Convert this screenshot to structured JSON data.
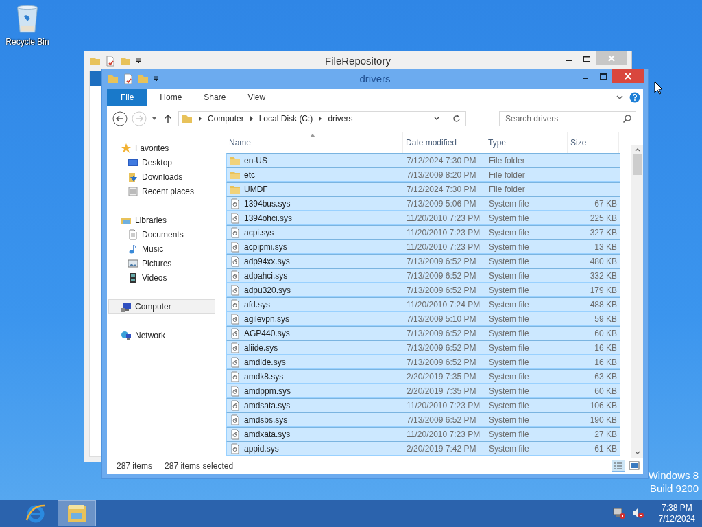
{
  "desktop": {
    "icons": [
      {
        "label": "Recycle Bin",
        "kind": "recycle"
      }
    ],
    "watermark": [
      "Windows 8",
      "Build 9200"
    ]
  },
  "back_window": {
    "title": "FileRepository"
  },
  "window": {
    "title": "drivers",
    "ribbon_tabs": [
      {
        "label": "File",
        "kind": "file"
      },
      {
        "label": "Home",
        "kind": "tab"
      },
      {
        "label": "Share",
        "kind": "tab"
      },
      {
        "label": "View",
        "kind": "tab"
      }
    ],
    "address": [
      "Computer",
      "Local Disk (C:)",
      "drivers"
    ],
    "search": {
      "placeholder": "Search drivers"
    },
    "nav": [
      {
        "label": "Favorites",
        "kind": "star",
        "selected": false,
        "children": [
          {
            "label": "Desktop",
            "kind": "desktop",
            "selected": false
          },
          {
            "label": "Downloads",
            "kind": "downloads",
            "selected": false
          },
          {
            "label": "Recent places",
            "kind": "recent",
            "selected": false
          }
        ]
      },
      {
        "label": "Libraries",
        "kind": "library",
        "selected": false,
        "children": [
          {
            "label": "Documents",
            "kind": "document",
            "selected": false
          },
          {
            "label": "Music",
            "kind": "music",
            "selected": false
          },
          {
            "label": "Pictures",
            "kind": "pictures",
            "selected": false
          },
          {
            "label": "Videos",
            "kind": "videos",
            "selected": false
          }
        ]
      },
      {
        "label": "Computer",
        "kind": "computer",
        "selected": true
      },
      {
        "label": "Network",
        "kind": "network",
        "selected": false
      }
    ],
    "columns": [
      "Name",
      "Date modified",
      "Type",
      "Size"
    ],
    "rows": [
      {
        "name": "en-US",
        "date": "7/12/2024 7:30 PM",
        "type": "File folder",
        "kind": "folder",
        "selected": true
      },
      {
        "name": "etc",
        "date": "7/13/2009 8:20 PM",
        "type": "File folder",
        "kind": "folder",
        "selected": true
      },
      {
        "name": "UMDF",
        "date": "7/12/2024 7:30 PM",
        "type": "File folder",
        "kind": "folder",
        "selected": true
      },
      {
        "name": "1394bus.sys",
        "date": "7/13/2009 5:06 PM",
        "type": "System file",
        "size": "67 KB",
        "kind": "file",
        "selected": true
      },
      {
        "name": "1394ohci.sys",
        "date": "11/20/2010 7:23 PM",
        "type": "System file",
        "size": "225 KB",
        "kind": "file",
        "selected": true
      },
      {
        "name": "acpi.sys",
        "date": "11/20/2010 7:23 PM",
        "type": "System file",
        "size": "327 KB",
        "kind": "file",
        "selected": true
      },
      {
        "name": "acpipmi.sys",
        "date": "11/20/2010 7:23 PM",
        "type": "System file",
        "size": "13 KB",
        "kind": "file",
        "selected": true
      },
      {
        "name": "adp94xx.sys",
        "date": "7/13/2009 6:52 PM",
        "type": "System file",
        "size": "480 KB",
        "kind": "file",
        "selected": true
      },
      {
        "name": "adpahci.sys",
        "date": "7/13/2009 6:52 PM",
        "type": "System file",
        "size": "332 KB",
        "kind": "file",
        "selected": true
      },
      {
        "name": "adpu320.sys",
        "date": "7/13/2009 6:52 PM",
        "type": "System file",
        "size": "179 KB",
        "kind": "file",
        "selected": true
      },
      {
        "name": "afd.sys",
        "date": "11/20/2010 7:24 PM",
        "type": "System file",
        "size": "488 KB",
        "kind": "file",
        "selected": true
      },
      {
        "name": "agilevpn.sys",
        "date": "7/13/2009 5:10 PM",
        "type": "System file",
        "size": "59 KB",
        "kind": "file",
        "selected": true
      },
      {
        "name": "AGP440.sys",
        "date": "7/13/2009 6:52 PM",
        "type": "System file",
        "size": "60 KB",
        "kind": "file",
        "selected": true
      },
      {
        "name": "aliide.sys",
        "date": "7/13/2009 6:52 PM",
        "type": "System file",
        "size": "16 KB",
        "kind": "file",
        "selected": true
      },
      {
        "name": "amdide.sys",
        "date": "7/13/2009 6:52 PM",
        "type": "System file",
        "size": "16 KB",
        "kind": "file",
        "selected": true
      },
      {
        "name": "amdk8.sys",
        "date": "2/20/2019 7:35 PM",
        "type": "System file",
        "size": "63 KB",
        "kind": "file",
        "selected": true
      },
      {
        "name": "amdppm.sys",
        "date": "2/20/2019 7:35 PM",
        "type": "System file",
        "size": "60 KB",
        "kind": "file",
        "selected": true
      },
      {
        "name": "amdsata.sys",
        "date": "11/20/2010 7:23 PM",
        "type": "System file",
        "size": "106 KB",
        "kind": "file",
        "selected": true
      },
      {
        "name": "amdsbs.sys",
        "date": "7/13/2009 6:52 PM",
        "type": "System file",
        "size": "190 KB",
        "kind": "file",
        "selected": true
      },
      {
        "name": "amdxata.sys",
        "date": "11/20/2010 7:23 PM",
        "type": "System file",
        "size": "27 KB",
        "kind": "file",
        "selected": true
      },
      {
        "name": "appid.sys",
        "date": "2/20/2019 7:42 PM",
        "type": "System file",
        "size": "61 KB",
        "kind": "file",
        "selected": true
      }
    ],
    "status": [
      "287 items",
      "287 items selected"
    ]
  },
  "taskbar": {
    "apps": [
      {
        "kind": "browser",
        "selected": false
      },
      {
        "kind": "explorer",
        "selected": true
      }
    ],
    "tray": {
      "time": "7:38 PM",
      "date": "7/12/2024"
    }
  }
}
